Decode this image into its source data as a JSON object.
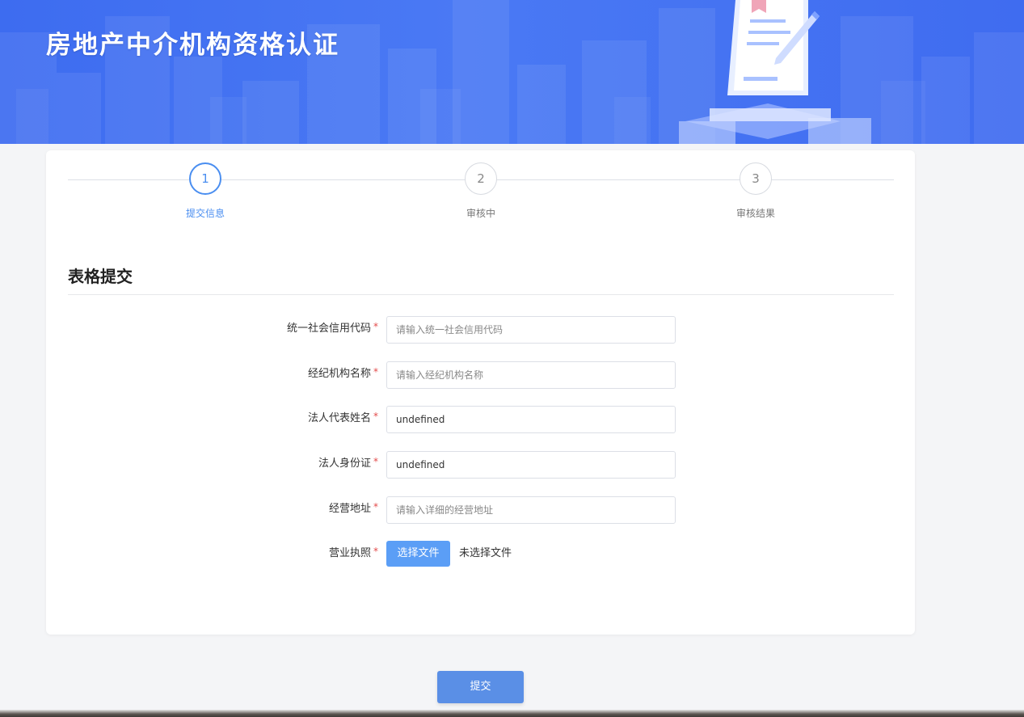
{
  "header": {
    "title": "房地产中介机构资格认证"
  },
  "steps": [
    {
      "number": "1",
      "label": "提交信息",
      "active": true
    },
    {
      "number": "2",
      "label": "审核中",
      "active": false
    },
    {
      "number": "3",
      "label": "审核结果",
      "active": false
    }
  ],
  "section": {
    "title": "表格提交"
  },
  "form": {
    "required_mark": "*",
    "fields": [
      {
        "label": "统一社会信用代码",
        "value": "",
        "placeholder": "请输入统一社会信用代码"
      },
      {
        "label": "经纪机构名称",
        "value": "",
        "placeholder": "请输入经纪机构名称"
      },
      {
        "label": "法人代表姓名",
        "value": "undefined",
        "placeholder": ""
      },
      {
        "label": "法人身份证",
        "value": "undefined",
        "placeholder": ""
      },
      {
        "label": "经营地址",
        "value": "",
        "placeholder": "请输入详细的经营地址"
      }
    ],
    "license": {
      "label": "营业执照",
      "button_label": "选择文件",
      "status": "未选择文件"
    }
  },
  "submit_label": "提交",
  "colors": {
    "banner": "#4676f2",
    "active_step": "#4a8ef0",
    "file_button": "#5b9ef6",
    "submit_button": "#5a8fe6",
    "required": "#e24b4b"
  }
}
